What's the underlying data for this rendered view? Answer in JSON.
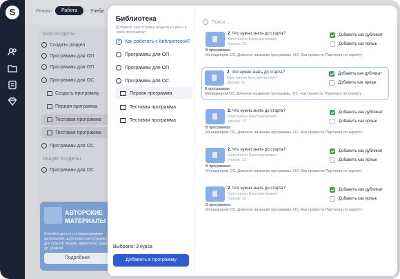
{
  "background": {
    "mode_label": "Режим:",
    "mode_active": "Работа",
    "mode_other": "Учеба",
    "my_sections": "МОИ РАЗДЕЛЫ",
    "create_section": "Создать раздел",
    "rows": [
      "Программы для ОП",
      "Программы для ОП",
      "Программы для ОС",
      "Создать программу",
      "Первая программа",
      "Тестовая программа",
      "Тестовая программа",
      "Программы для ОС"
    ],
    "common_sections": "ОБЩИЕ РАЗДЕЛЫ",
    "common_row": "Программы для ОС",
    "promo_title": "АВТОРСКИЕ МАТЕРИАЛЫ",
    "promo_text": "Откройте доступ к готовым премиум-материалам, шаблонам и инструкциям для отделов продаж, маркетинга, кадров и др. уровней",
    "promo_button": "Подробнее"
  },
  "library": {
    "title": "Библиотека",
    "subtitle": "Добавьте уже готовые модули и курсы в свою программу!",
    "help_link": "Как работать с библиотекой?",
    "items": [
      "Программы для ОП",
      "Программы для ОП",
      "Программы для ОС"
    ],
    "folders": [
      "Первая программа",
      "Тестовая программа",
      "Тестовая программа"
    ],
    "selected_label": "Выбрано: 3 курса",
    "add_button": "Добавить в программу"
  },
  "search": {
    "placeholder": "Поиск..."
  },
  "courses": [
    {
      "num": "2.",
      "title": "Что нужно знать до старта?",
      "author": "Константин Константинович",
      "lessons": "Уроков: 12",
      "in_programs": "В программах:",
      "programs": "Менеджером ОС, Длинное название программы, ОС- Как провести Партнера по скрипту",
      "dup": "Добавить как дубликат",
      "shortcut": "Добавить как ярлык"
    },
    {
      "num": "2.",
      "title": "Что нужно знать до старта?",
      "author": "Константин Константинович",
      "lessons": "Уроков: 12",
      "in_programs": "В программах:",
      "programs": "Менеджером ОС, Длинное название программы, ОС- Как провести Партнера по скрипту",
      "dup": "Добавить как дубликат",
      "shortcut": "Добавить как ярлык"
    },
    {
      "num": "2.",
      "title": "Что нужно знать до старта?",
      "author": "Константин Константинович",
      "lessons": "Уроков: 12",
      "in_programs": "В программах:",
      "programs": "Менеджером ОС, Длинное название программы, ОС- Как провести Партнера по скрипту",
      "dup": "Добавить как дубликат",
      "shortcut": "Добавить как ярлык"
    },
    {
      "num": "2.",
      "title": "Что нужно знать до старта?",
      "author": "Константин Константинович",
      "lessons": "Уроков: 12",
      "in_programs": "В программах:",
      "programs": "Менеджером ОС, Длинное название программы, ОС- Как провести Партнера по скрипту",
      "dup": "Добавить как дубликат",
      "shortcut": "Добавить как ярлык"
    },
    {
      "num": "2.",
      "title": "Что нужно знать до старта?",
      "author": "Константин Константинович",
      "lessons": "Уроков: 12",
      "in_programs": "В программах:",
      "programs": "Менеджером ОС, Длинное название программы, ОС- Как провести Партнера по скрипту",
      "dup": "Добавить как дубликат",
      "shortcut": "Добавить как ярлык"
    }
  ],
  "colors": {
    "accent": "#2f5bd2",
    "rail": "#1a2333",
    "check": "#4f9a58"
  }
}
